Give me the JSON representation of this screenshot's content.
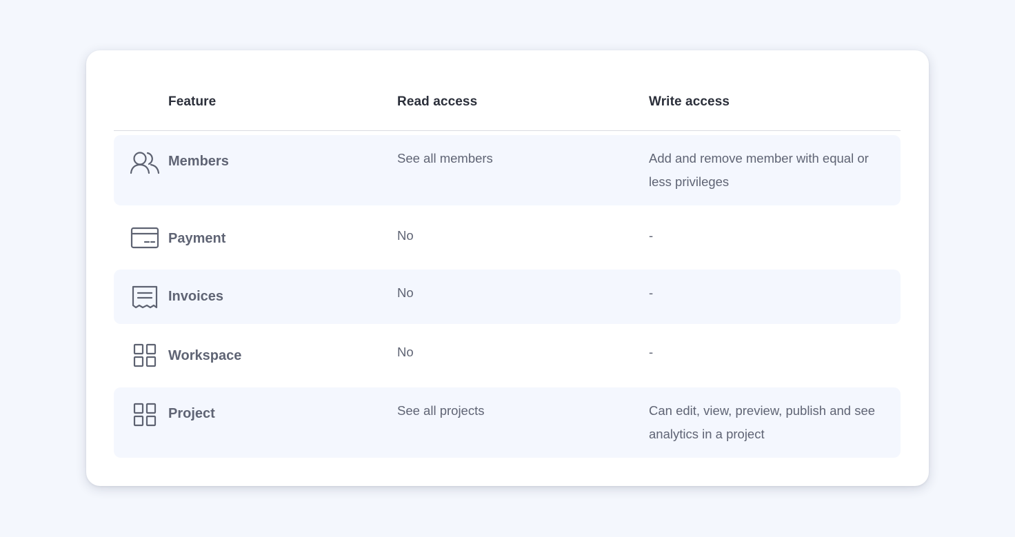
{
  "header": {
    "feature": "Feature",
    "read": "Read access",
    "write": "Write access"
  },
  "rows": [
    {
      "feature": "Members",
      "icon": "users-icon",
      "read": "See all members",
      "write": "Add and remove member with equal or less privileges"
    },
    {
      "feature": "Payment",
      "icon": "credit-card-icon",
      "read": "No",
      "write": "-"
    },
    {
      "feature": "Invoices",
      "icon": "receipt-icon",
      "read": "No",
      "write": "-"
    },
    {
      "feature": "Workspace",
      "icon": "grid-icon",
      "read": "No",
      "write": "-"
    },
    {
      "feature": "Project",
      "icon": "grid-icon",
      "read": "See all projects",
      "write": "Can edit, view, preview, publish and see analytics in a project"
    }
  ],
  "colors": {
    "background": "#f4f7fd",
    "card": "#ffffff",
    "row_alt": "#f4f7fe",
    "header_text": "#2b2f3a",
    "body_text": "#5f6474"
  }
}
